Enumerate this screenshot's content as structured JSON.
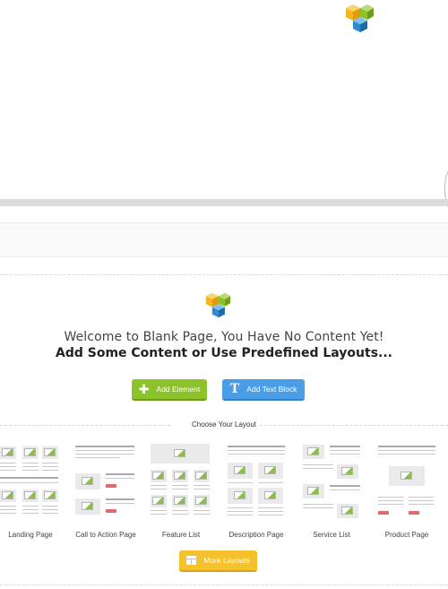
{
  "welcome": {
    "line1": "Welcome to Blank Page, You Have No Content Yet!",
    "line2": "Add Some Content or Use Predefined Layouts..."
  },
  "buttons": {
    "add_element": "Add Element",
    "add_text_block": "Add Text Block",
    "more_layouts": "More Layouts"
  },
  "choose_layout": "Choose Your Layout",
  "layouts": [
    "Landing Page",
    "Call to Action Page",
    "Feature List",
    "Description Page",
    "Service List",
    "Product Page"
  ],
  "icons": {
    "logo": "visual-composer-logo",
    "add_element": "plus-icon",
    "add_text_block": "text-t-icon",
    "more_layouts": "layout-grid-icon"
  },
  "colors": {
    "green": "#8cc32a",
    "blue": "#4a9ee6",
    "yellow": "#f5c12d",
    "logo_yellow": "#f5b51c",
    "logo_green": "#8cc32a",
    "logo_blue": "#2e8bd0"
  }
}
